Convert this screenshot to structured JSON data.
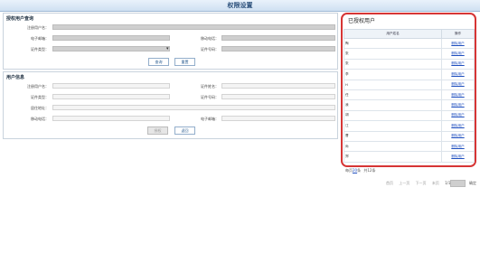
{
  "page_title": "权限设置",
  "search_section": {
    "title": "授权用户查询",
    "fields": {
      "registered_user_name": "注册用户名：",
      "email": "电子邮箱：",
      "mobile": "移动电话：",
      "id_type": "证件类型：",
      "id_number": "证件号码："
    },
    "buttons": {
      "query": "查询",
      "reset": "重置"
    }
  },
  "user_info_section": {
    "title": "用户信息",
    "fields": {
      "registered_user_name": "注册用户名：",
      "user_name": "证件姓名：",
      "id_type": "证件类型：",
      "id_number": "证件号码：",
      "address": "居住地址：",
      "mobile": "移动电话：",
      "email": "电子邮箱："
    },
    "buttons": {
      "authorize": "授权",
      "back": "返回"
    }
  },
  "granted_users": {
    "title": "已授权用户",
    "columns": {
      "name": "用户姓名",
      "action": "操作"
    },
    "rows": [
      {
        "name": "陶",
        "action": "删除用户"
      },
      {
        "name": "张",
        "action": "删除用户"
      },
      {
        "name": "张",
        "action": "删除用户"
      },
      {
        "name": "李",
        "action": "删除用户"
      },
      {
        "name": "H",
        "action": "删除用户"
      },
      {
        "name": "任",
        "action": "删除用户"
      },
      {
        "name": "我",
        "action": "删除用户"
      },
      {
        "name": "胡",
        "action": "删除用户"
      },
      {
        "name": "江",
        "action": "删除用户"
      },
      {
        "name": "曹",
        "action": "删除用户"
      },
      {
        "name": "尚",
        "action": "删除用户"
      },
      {
        "name": "郑",
        "action": "删除用户"
      }
    ]
  },
  "pagination": {
    "per_page_prefix": "每页",
    "per_page_value": "20",
    "per_page_suffix": "条",
    "total": "共12条",
    "first": "首页",
    "prev": "上一页",
    "next": "下一页",
    "last": "末页",
    "page_info": "1/1页",
    "go": "确定"
  },
  "colors": {
    "highlight_border": "#d63535",
    "link": "#1f4fbf"
  }
}
